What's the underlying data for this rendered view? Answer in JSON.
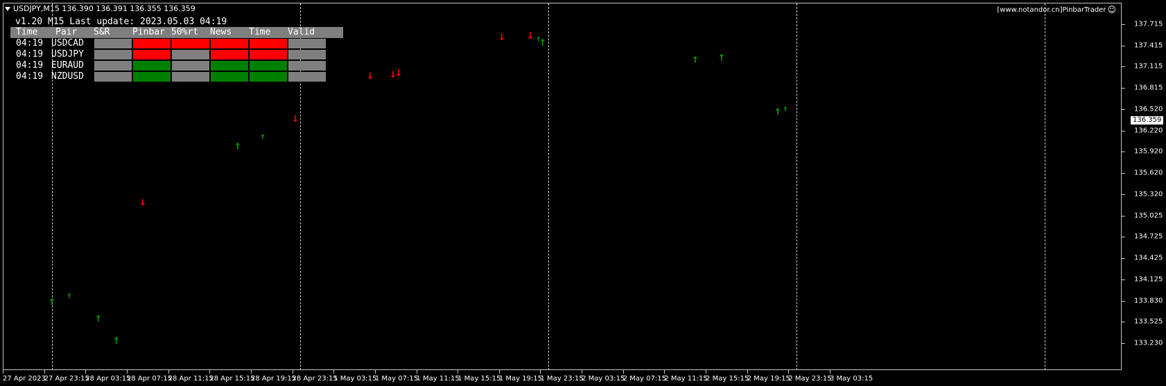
{
  "window": {
    "symbol_info": "USDJPY,M15  136.390 136.391 136.355 136.359",
    "brand": "[www.notandor.cn]PinbarTrader",
    "brand_icon": "smiley-icon"
  },
  "panel": {
    "title": "v1.20 M15 Last update: 2023.05.03 04:19",
    "columns": [
      "Time",
      "Pair",
      "S&R",
      "Pinbar",
      "50%rt",
      "News",
      "Time",
      "Valid"
    ],
    "colors": {
      "gray": "#7f7f7f",
      "red": "#ff0000",
      "green": "#008000"
    },
    "rows": [
      {
        "time": "04:19",
        "pair": "USDCAD",
        "cells": [
          "gray",
          "red",
          "red",
          "red",
          "red",
          "gray"
        ]
      },
      {
        "time": "04:19",
        "pair": "USDJPY",
        "cells": [
          "gray",
          "red",
          "gray",
          "red",
          "red",
          "gray"
        ]
      },
      {
        "time": "04:19",
        "pair": "EURAUD",
        "cells": [
          "gray",
          "green",
          "gray",
          "green",
          "green",
          "gray"
        ]
      },
      {
        "time": "04:19",
        "pair": "NZDUSD",
        "cells": [
          "gray",
          "green",
          "gray",
          "green",
          "green",
          "gray"
        ]
      }
    ]
  },
  "price_axis": {
    "labels": [
      "137.715",
      "137.415",
      "137.115",
      "136.815",
      "136.520",
      "136.220",
      "135.920",
      "135.620",
      "135.320",
      "135.025",
      "134.725",
      "134.425",
      "134.125",
      "133.830",
      "133.525",
      "133.230"
    ],
    "current_price": "136.359"
  },
  "time_axis": {
    "labels": [
      "27 Apr 2023",
      "27 Apr 23:15",
      "28 Apr 03:15",
      "28 Apr 07:15",
      "28 Apr 11:15",
      "28 Apr 15:15",
      "28 Apr 19:15",
      "28 Apr 23:15",
      "1 May 03:15",
      "1 May 07:15",
      "1 May 11:15",
      "1 May 15:15",
      "1 May 19:15",
      "1 May 23:15",
      "2 May 03:15",
      "2 May 07:15",
      "2 May 11:15",
      "2 May 15:15",
      "2 May 19:15",
      "2 May 23:15",
      "3 May 03:15"
    ]
  },
  "signals": {
    "up_color": "#00a000",
    "down_color": "#ff0000"
  }
}
